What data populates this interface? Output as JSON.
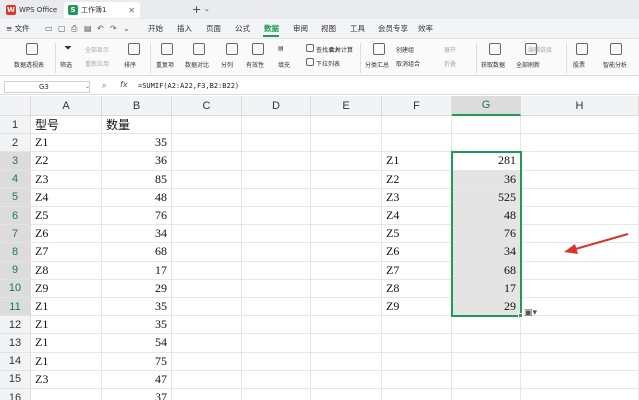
{
  "title_bar": {
    "app_tab": "WPS Office",
    "app_logo": "W",
    "doc_tab": "工作簿1",
    "doc_logo": "S",
    "close_glyph": "✕",
    "new_tab_glyph": "+",
    "new_tab_caret": "⌄"
  },
  "menu": {
    "file": "≡ 文件",
    "items": [
      "开始",
      "插入",
      "页面",
      "公式",
      "数据",
      "审阅",
      "视图",
      "工具",
      "会员专享",
      "效率"
    ],
    "active": "数据"
  },
  "ribbon": {
    "pivot": "数据透视表",
    "filter": "筛选",
    "show_all": "全部显示",
    "reapply": "重新应用",
    "sort": "排序",
    "duplicates": "重复项",
    "compare": "数据对比",
    "split": "分列",
    "validity": "有效性",
    "fill": "填充",
    "lookup": "查找录入",
    "consolidate": "合并计算",
    "dropdown": "下拉列表",
    "subtotal": "分类汇总",
    "group": "创建组",
    "ungroup": "取消组合",
    "expand": "展开",
    "collapse": "折叠",
    "get_data": "获取数据",
    "refresh_all": "全部刷新",
    "edit_links": "编辑链接",
    "stocks": "股票",
    "analysis": "智能分析"
  },
  "formula_bar": {
    "name_box": "G3",
    "fx": "fx",
    "formula": "=SUMIF(A2:A22,F3,B2:B22)"
  },
  "columns": [
    "A",
    "B",
    "C",
    "D",
    "E",
    "F",
    "G",
    "H"
  ],
  "selected_column": "G",
  "rows": [
    "1",
    "2",
    "3",
    "4",
    "5",
    "6",
    "7",
    "8",
    "9",
    "10",
    "11",
    "12",
    "13",
    "14",
    "15",
    "16"
  ],
  "colA": [
    "型号",
    "Z1",
    "Z2",
    "Z3",
    "Z4",
    "Z5",
    "Z6",
    "Z7",
    "Z8",
    "Z9",
    "Z1",
    "Z1",
    "Z1",
    "Z1",
    "Z3",
    ""
  ],
  "colB": [
    "数量",
    "35",
    "36",
    "85",
    "48",
    "76",
    "34",
    "68",
    "17",
    "29",
    "35",
    "35",
    "54",
    "75",
    "47",
    "37"
  ],
  "colF": [
    "",
    "",
    "Z1",
    "Z2",
    "Z3",
    "Z4",
    "Z5",
    "Z6",
    "Z7",
    "Z8",
    "Z9",
    "",
    "",
    "",
    "",
    ""
  ],
  "colG": [
    "",
    "",
    "281",
    "36",
    "525",
    "48",
    "76",
    "34",
    "68",
    "17",
    "29",
    "",
    "",
    "",
    "",
    ""
  ],
  "paste_options_glyph": "▣▾",
  "annotation_arrow_color": "#d9342b",
  "accent_color": "#1f9a57"
}
